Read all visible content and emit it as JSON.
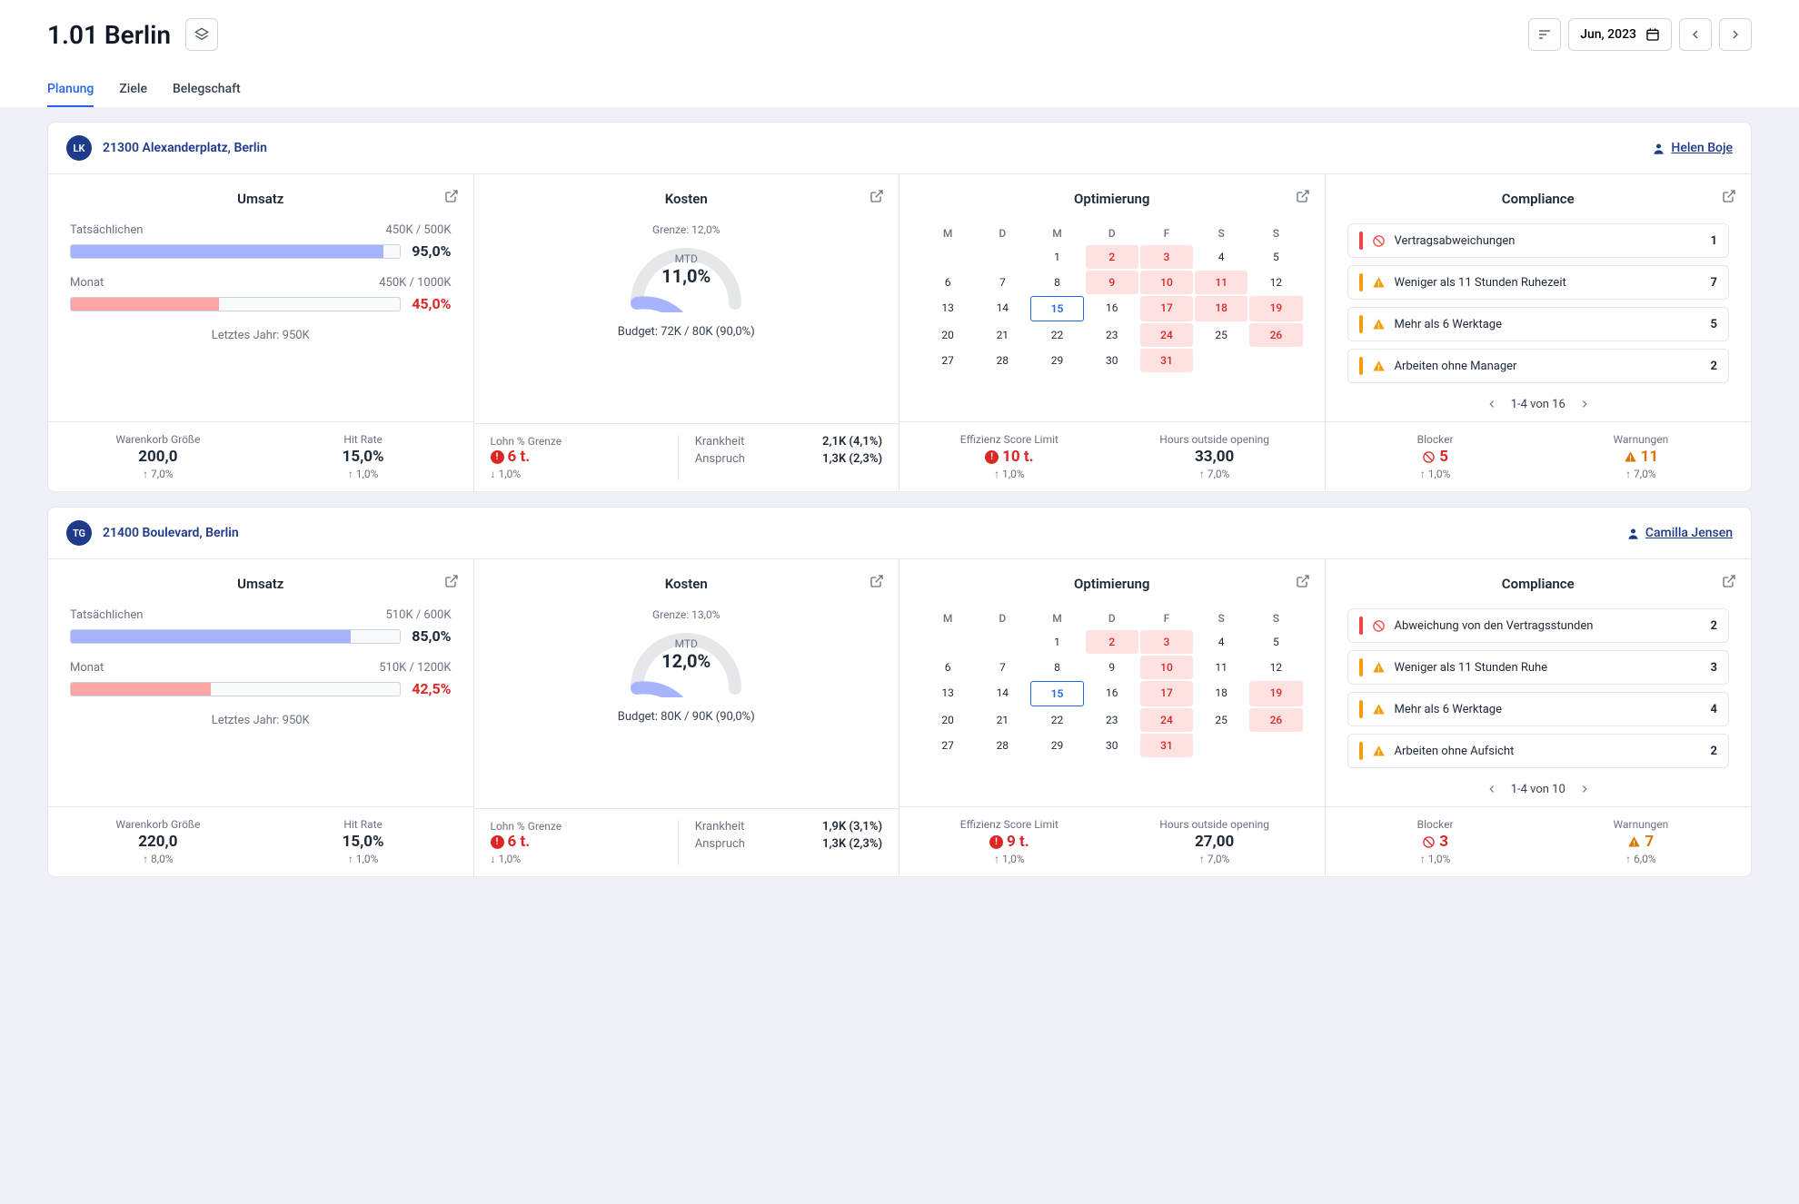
{
  "header": {
    "title": "1.01 Berlin",
    "date_label": "Jun, 2023"
  },
  "tabs": [
    {
      "label": "Planung",
      "active": true
    },
    {
      "label": "Ziele",
      "active": false
    },
    {
      "label": "Belegschaft",
      "active": false
    }
  ],
  "labels": {
    "umsatz": "Umsatz",
    "kosten": "Kosten",
    "optimierung": "Optimierung",
    "compliance": "Compliance",
    "tatsaechlichen": "Tatsächlichen",
    "monat": "Monat",
    "letztes_jahr": "Letztes Jahr:",
    "warenkorb": "Warenkorb Größe",
    "hit_rate": "Hit Rate",
    "grenze": "Grenze:",
    "mtd": "MTD",
    "budget": "Budget:",
    "lohn_grenze": "Lohn % Grenze",
    "krankheit": "Krankheit",
    "anspruch": "Anspruch",
    "effizienz": "Effizienz Score Limit",
    "hours_outside": "Hours outside opening",
    "blocker": "Blocker",
    "warnungen": "Warnungen",
    "von": "von"
  },
  "weekdays": [
    "M",
    "D",
    "M",
    "D",
    "F",
    "S",
    "S"
  ],
  "stores": [
    {
      "avatar": "LK",
      "name": "21300 Alexanderplatz, Berlin",
      "manager": "Helen Boje",
      "umsatz": {
        "tat_values": "450K / 500K",
        "tat_pct": "95,0%",
        "tat_fill": 95,
        "tat_color": "#a5b4fc",
        "monat_values": "450K / 1000K",
        "monat_pct": "45,0%",
        "monat_fill": 45,
        "last_year": "950K",
        "warenkorb_val": "200,0",
        "warenkorb_delta": "↑ 7,0%",
        "hitrate_val": "15,0%",
        "hitrate_delta": "↑ 1,0%"
      },
      "kosten": {
        "grenze": "12,0%",
        "mtd": "11,0%",
        "gauge_fill": 0.55,
        "budget": "72K / 80K (90,0%)",
        "lohn_val": "6 t.",
        "lohn_delta": "↓ 1,0%",
        "krankheit": "2,1K (4,1%)",
        "anspruch": "1,3K (2,3%)"
      },
      "calendar": {
        "cells": [
          {
            "v": ""
          },
          {
            "v": ""
          },
          {
            "v": "1"
          },
          {
            "v": "2",
            "red": true
          },
          {
            "v": "3",
            "red": true
          },
          {
            "v": "4"
          },
          {
            "v": "5"
          },
          {
            "v": "6"
          },
          {
            "v": "7"
          },
          {
            "v": "8"
          },
          {
            "v": "9",
            "red": true
          },
          {
            "v": "10",
            "red": true
          },
          {
            "v": "11",
            "red": true
          },
          {
            "v": "12"
          },
          {
            "v": "13"
          },
          {
            "v": "14"
          },
          {
            "v": "15",
            "today": true
          },
          {
            "v": "16"
          },
          {
            "v": "17",
            "red": true
          },
          {
            "v": "18",
            "red": true
          },
          {
            "v": "19",
            "red": true
          },
          {
            "v": "20"
          },
          {
            "v": "21"
          },
          {
            "v": "22"
          },
          {
            "v": "23"
          },
          {
            "v": "24",
            "red": true
          },
          {
            "v": "25"
          },
          {
            "v": "26",
            "red": true
          },
          {
            "v": "27"
          },
          {
            "v": "28"
          },
          {
            "v": "29"
          },
          {
            "v": "30"
          },
          {
            "v": "31",
            "red": true
          },
          {
            "v": ""
          },
          {
            "v": ""
          }
        ],
        "eff_val": "10 t.",
        "eff_delta": "↑ 1,0%",
        "hours_val": "33,00",
        "hours_delta": "↑ 7,0%"
      },
      "compliance": {
        "items": [
          {
            "icon": "ban",
            "color": "#ef4444",
            "text": "Vertragsabweichungen",
            "count": "1"
          },
          {
            "icon": "warn",
            "color": "#f59e0b",
            "text": "Weniger als 11 Stunden Ruhezeit",
            "count": "7"
          },
          {
            "icon": "warn",
            "color": "#f59e0b",
            "text": "Mehr als 6 Werktage",
            "count": "5"
          },
          {
            "icon": "warn",
            "color": "#f59e0b",
            "text": "Arbeiten ohne Manager",
            "count": "2"
          }
        ],
        "pager": "1-4 von 16",
        "blocker_val": "5",
        "blocker_delta": "↑ 1,0%",
        "warn_val": "11",
        "warn_delta": "↑ 7,0%"
      }
    },
    {
      "avatar": "TG",
      "name": "21400 Boulevard, Berlin",
      "manager": "Camilla Jensen",
      "umsatz": {
        "tat_values": "510K / 600K",
        "tat_pct": "85,0%",
        "tat_fill": 85,
        "tat_color": "#a5b4fc",
        "monat_values": "510K / 1200K",
        "monat_pct": "42,5%",
        "monat_fill": 42.5,
        "last_year": "950K",
        "warenkorb_val": "220,0",
        "warenkorb_delta": "↑ 8,0%",
        "hitrate_val": "15,0%",
        "hitrate_delta": "↑ 1,0%"
      },
      "kosten": {
        "grenze": "13,0%",
        "mtd": "12,0%",
        "gauge_fill": 0.55,
        "budget": "80K / 90K (90,0%)",
        "lohn_val": "6 t.",
        "lohn_delta": "↓ 1,0%",
        "krankheit": "1,9K (3,1%)",
        "anspruch": "1,3K (2,3%)"
      },
      "calendar": {
        "cells": [
          {
            "v": ""
          },
          {
            "v": ""
          },
          {
            "v": "1"
          },
          {
            "v": "2",
            "red": true
          },
          {
            "v": "3",
            "red": true
          },
          {
            "v": "4"
          },
          {
            "v": "5"
          },
          {
            "v": "6"
          },
          {
            "v": "7"
          },
          {
            "v": "8"
          },
          {
            "v": "9"
          },
          {
            "v": "10",
            "red": true
          },
          {
            "v": "11"
          },
          {
            "v": "12"
          },
          {
            "v": "13"
          },
          {
            "v": "14"
          },
          {
            "v": "15",
            "today": true
          },
          {
            "v": "16"
          },
          {
            "v": "17",
            "red": true
          },
          {
            "v": "18"
          },
          {
            "v": "19",
            "red": true
          },
          {
            "v": "20"
          },
          {
            "v": "21"
          },
          {
            "v": "22"
          },
          {
            "v": "23"
          },
          {
            "v": "24",
            "red": true
          },
          {
            "v": "25"
          },
          {
            "v": "26",
            "red": true
          },
          {
            "v": "27"
          },
          {
            "v": "28"
          },
          {
            "v": "29"
          },
          {
            "v": "30"
          },
          {
            "v": "31",
            "red": true
          },
          {
            "v": ""
          },
          {
            "v": ""
          }
        ],
        "eff_val": "9 t.",
        "eff_delta": "↑ 1,0%",
        "hours_val": "27,00",
        "hours_delta": "↑ 7,0%"
      },
      "compliance": {
        "items": [
          {
            "icon": "ban",
            "color": "#ef4444",
            "text": "Abweichung von den Vertragsstunden",
            "count": "2"
          },
          {
            "icon": "warn",
            "color": "#f59e0b",
            "text": "Weniger als 11 Stunden Ruhe",
            "count": "3"
          },
          {
            "icon": "warn",
            "color": "#f59e0b",
            "text": "Mehr als 6 Werktage",
            "count": "4"
          },
          {
            "icon": "warn",
            "color": "#f59e0b",
            "text": "Arbeiten ohne Aufsicht",
            "count": "2"
          }
        ],
        "pager": "1-4 von 10",
        "blocker_val": "3",
        "blocker_delta": "↑ 1,0%",
        "warn_val": "7",
        "warn_delta": "↑ 6,0%"
      }
    }
  ]
}
